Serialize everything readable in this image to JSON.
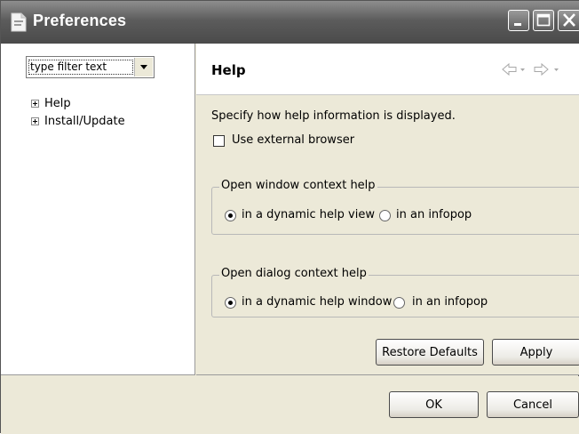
{
  "window": {
    "title": "Preferences"
  },
  "sidebar": {
    "filter_text": "type filter text",
    "items": [
      {
        "label": "Help"
      },
      {
        "label": "Install/Update"
      }
    ]
  },
  "page": {
    "title": "Help",
    "description": "Specify how help information is displayed.",
    "external_browser": {
      "label": "Use external browser",
      "checked": false
    },
    "window_help": {
      "legend": "Open window context help",
      "options": [
        "in a dynamic help view",
        "in an infopop"
      ],
      "selected": "in a dynamic help view"
    },
    "dialog_help": {
      "legend": "Open dialog context help",
      "options": [
        "in a dynamic help window",
        "in an infopop"
      ],
      "selected": "in a dynamic help window"
    },
    "restore_defaults_label": "Restore Defaults",
    "apply_label": "Apply"
  },
  "footer": {
    "ok_label": "OK",
    "cancel_label": "Cancel"
  },
  "icons": {
    "app": "preferences-page-icon",
    "nav_back": "back-arrow-icon",
    "nav_forward": "forward-arrow-icon"
  }
}
